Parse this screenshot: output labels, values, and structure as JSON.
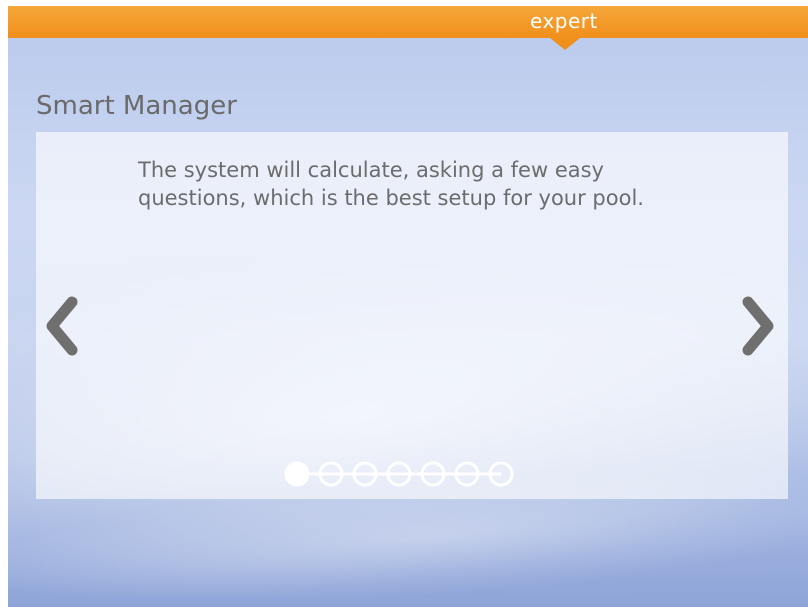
{
  "header": {
    "mode_label": "expert"
  },
  "page": {
    "title": "Smart Manager",
    "description": "The system will calculate, asking a few easy questions, which is the best setup for your pool."
  },
  "pager": {
    "total_pages": 7,
    "current_page": 1
  },
  "icons": {
    "prev": "chevron-left-icon",
    "next": "chevron-right-icon"
  },
  "colors": {
    "accent": "#f08f1c",
    "text": "#6c6c6c",
    "arrow": "#6f6f6f",
    "dot": "#ffffff"
  }
}
